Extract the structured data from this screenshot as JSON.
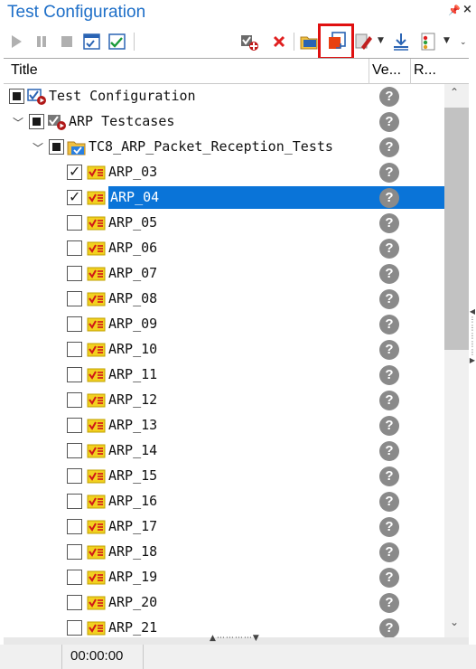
{
  "window": {
    "title": "Test Configuration"
  },
  "columns": {
    "title": "Title",
    "verdict": "Ve...",
    "result": "R..."
  },
  "tree": [
    {
      "label": "Test Configuration",
      "level": 0,
      "expander": "",
      "check": "partial",
      "icon": "test-configuration-icon",
      "verdict": "?"
    },
    {
      "label": "ARP Testcases",
      "level": 1,
      "expander": "v",
      "check": "partial",
      "icon": "test-group-icon",
      "verdict": "?"
    },
    {
      "label": "TC8_ARP_Packet_Reception_Tests",
      "level": 2,
      "expander": "v",
      "check": "partial",
      "icon": "test-folder-icon",
      "verdict": "?"
    },
    {
      "label": "ARP_03",
      "level": 3,
      "check": "on",
      "icon": "test-case-icon",
      "verdict": "?"
    },
    {
      "label": "ARP_04",
      "level": 3,
      "check": "on",
      "icon": "test-case-icon",
      "verdict": "?",
      "selected": true
    },
    {
      "label": "ARP_05",
      "level": 3,
      "check": "off",
      "icon": "test-case-icon",
      "verdict": "?"
    },
    {
      "label": "ARP_06",
      "level": 3,
      "check": "off",
      "icon": "test-case-icon",
      "verdict": "?"
    },
    {
      "label": "ARP_07",
      "level": 3,
      "check": "off",
      "icon": "test-case-icon",
      "verdict": "?"
    },
    {
      "label": "ARP_08",
      "level": 3,
      "check": "off",
      "icon": "test-case-icon",
      "verdict": "?"
    },
    {
      "label": "ARP_09",
      "level": 3,
      "check": "off",
      "icon": "test-case-icon",
      "verdict": "?"
    },
    {
      "label": "ARP_10",
      "level": 3,
      "check": "off",
      "icon": "test-case-icon",
      "verdict": "?"
    },
    {
      "label": "ARP_11",
      "level": 3,
      "check": "off",
      "icon": "test-case-icon",
      "verdict": "?"
    },
    {
      "label": "ARP_12",
      "level": 3,
      "check": "off",
      "icon": "test-case-icon",
      "verdict": "?"
    },
    {
      "label": "ARP_13",
      "level": 3,
      "check": "off",
      "icon": "test-case-icon",
      "verdict": "?"
    },
    {
      "label": "ARP_14",
      "level": 3,
      "check": "off",
      "icon": "test-case-icon",
      "verdict": "?"
    },
    {
      "label": "ARP_15",
      "level": 3,
      "check": "off",
      "icon": "test-case-icon",
      "verdict": "?"
    },
    {
      "label": "ARP_16",
      "level": 3,
      "check": "off",
      "icon": "test-case-icon",
      "verdict": "?"
    },
    {
      "label": "ARP_17",
      "level": 3,
      "check": "off",
      "icon": "test-case-icon",
      "verdict": "?"
    },
    {
      "label": "ARP_18",
      "level": 3,
      "check": "off",
      "icon": "test-case-icon",
      "verdict": "?"
    },
    {
      "label": "ARP_19",
      "level": 3,
      "check": "off",
      "icon": "test-case-icon",
      "verdict": "?"
    },
    {
      "label": "ARP_20",
      "level": 3,
      "check": "off",
      "icon": "test-case-icon",
      "verdict": "?"
    },
    {
      "label": "ARP_21",
      "level": 3,
      "check": "off",
      "icon": "test-case-icon",
      "verdict": "?"
    }
  ],
  "status": {
    "elapsed": "00:00:00"
  },
  "colors": {
    "title": "#1e6fc8",
    "selection": "#0a74d8",
    "highlight_box": "#e01010",
    "arrow": "#e01818",
    "verdict_unknown": "#8a8a8a"
  }
}
